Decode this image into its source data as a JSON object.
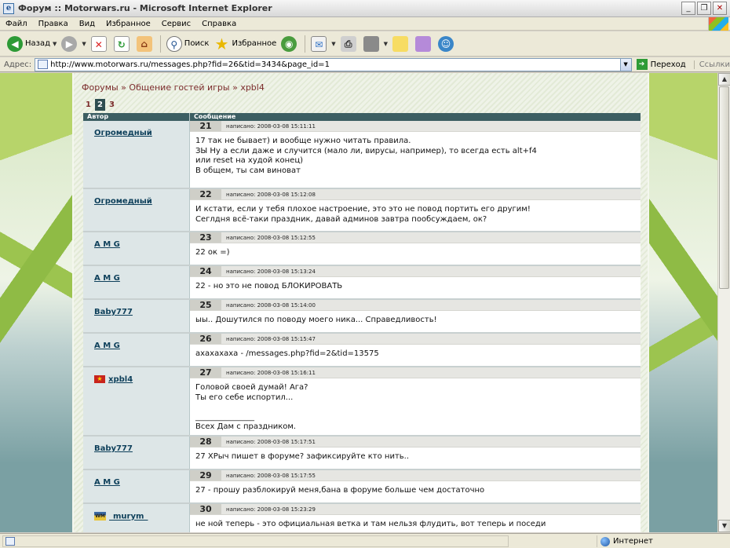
{
  "window": {
    "title": "Форум :: Motorwars.ru - Microsoft Internet Explorer"
  },
  "menu": [
    "Файл",
    "Правка",
    "Вид",
    "Избранное",
    "Сервис",
    "Справка"
  ],
  "toolbar": {
    "back": "Назад",
    "search": "Поиск",
    "favorites": "Избранное"
  },
  "address": {
    "label": "Адрес:",
    "url": "http://www.motorwars.ru/messages.php?fid=26&tid=3434&page_id=1",
    "go": "Переход",
    "links": "Ссылки"
  },
  "page": {
    "breadcrumb": {
      "forums": "Форумы",
      "sep": " » ",
      "section": "Общение гостей игры",
      "topic": "xpbl4"
    },
    "pages": [
      "1",
      "2",
      "3"
    ],
    "current_page": "2",
    "header": {
      "author": "Автор",
      "message": "Сообщение"
    },
    "posts": [
      {
        "num": "21",
        "author": "Огромедный",
        "meta": "написано: 2008-03-08 15:11:11",
        "text": "17 так не бывает) и вообще нужно читать правила.\nЗЫ Ну а если даже и случится (мало ли, вирусы, например), то всегда есть alt+f4\nили reset на худой конец)\nВ общем, ты сам виноват"
      },
      {
        "num": "22",
        "author": "Огромедный",
        "meta": "написано: 2008-03-08 15:12:08",
        "text": "И кстати, если у тебя плохое настроение, это это не повод портить его другим!\nСеглдня всё-таки праздник, давай админов завтра пообсуждаем, ок?"
      },
      {
        "num": "23",
        "author": "A M G",
        "meta": "написано: 2008-03-08 15:12:55",
        "text": "22 ок =)"
      },
      {
        "num": "24",
        "author": "A M G",
        "meta": "написано: 2008-03-08 15:13:24",
        "text": "22 - но это не повод БЛОКИРОВАТЬ"
      },
      {
        "num": "25",
        "author": "Baby777",
        "meta": "написано: 2008-03-08 15:14:00",
        "text": "ыы.. Дошутился по поводу моего ника... Справедливость!"
      },
      {
        "num": "26",
        "author": "A M G",
        "meta": "написано: 2008-03-08 15:15:47",
        "text": "ахахахаха - /messages.php?fid=2&tid=13575"
      },
      {
        "num": "27",
        "author": "xpbl4",
        "meta": "написано: 2008-03-08 15:16:11",
        "text": "Головой своей думай! Ага?\nТы его себе испортил...\n\n_______________\nВсех Дам с праздником."
      },
      {
        "num": "28",
        "author": "Baby777",
        "meta": "написано: 2008-03-08 15:17:51",
        "text": "27 ХРыч пишет в форуме? зафиксируйте кто нить.."
      },
      {
        "num": "29",
        "author": "A M G",
        "meta": "написано: 2008-03-08 15:17:55",
        "text": "27 - прошу разблокируй меня,бана в форуме больше чем достаточно"
      },
      {
        "num": "30",
        "author": "_murym_",
        "meta": "написано: 2008-03-08 15:23:29",
        "text": "не ной теперь - это официальная ветка и там нельзя флудить, вот теперь и поседи"
      }
    ]
  },
  "status": {
    "zone": "Интернет"
  }
}
